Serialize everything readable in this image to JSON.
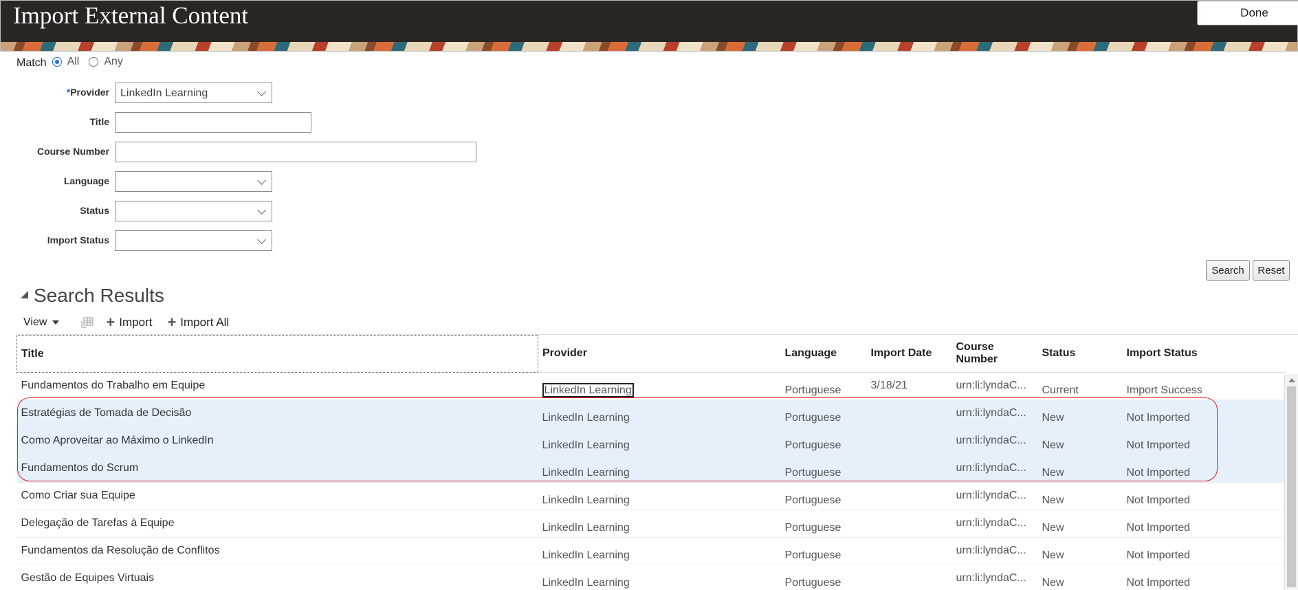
{
  "header": {
    "title": "Import External Content",
    "done_label": "Done"
  },
  "search_form": {
    "match_label": "Match",
    "match_options": [
      "All",
      "Any"
    ],
    "match_selected": "All",
    "provider": {
      "label": "Provider",
      "required_mark": "*",
      "value": "LinkedIn Learning"
    },
    "title": {
      "label": "Title",
      "value": ""
    },
    "course_number": {
      "label": "Course Number",
      "value": ""
    },
    "language": {
      "label": "Language",
      "value": ""
    },
    "status": {
      "label": "Status",
      "value": ""
    },
    "import_status": {
      "label": "Import Status",
      "value": ""
    },
    "search_label": "Search",
    "reset_label": "Reset"
  },
  "results": {
    "section_title": "Search Results",
    "toolbar": {
      "view_label": "View",
      "import_label": "Import",
      "import_all_label": "Import All"
    },
    "columns": {
      "title": "Title",
      "provider": "Provider",
      "language": "Language",
      "import_date": "Import Date",
      "course_number_1": "Course",
      "course_number_2": "Number",
      "status": "Status",
      "import_status": "Import Status"
    },
    "rows": [
      {
        "title": "Fundamentos do Trabalho em Equipe",
        "provider": "LinkedIn Learning",
        "language": "Portuguese",
        "import_date": "3/18/21",
        "course_number": "urn:li:lyndaC...",
        "status": "Current",
        "import_status": "Import Success"
      },
      {
        "title": "Estratégias de Tomada de Decisão",
        "provider": "LinkedIn Learning",
        "language": "Portuguese",
        "import_date": "",
        "course_number": "urn:li:lyndaC...",
        "status": "New",
        "import_status": "Not Imported"
      },
      {
        "title": "Como Aproveitar ao Máximo o LinkedIn",
        "provider": "LinkedIn Learning",
        "language": "Portuguese",
        "import_date": "",
        "course_number": "urn:li:lyndaC...",
        "status": "New",
        "import_status": "Not Imported"
      },
      {
        "title": "Fundamentos do Scrum",
        "provider": "LinkedIn Learning",
        "language": "Portuguese",
        "import_date": "",
        "course_number": "urn:li:lyndaC...",
        "status": "New",
        "import_status": "Not Imported"
      },
      {
        "title": "Como Criar sua Equipe",
        "provider": "LinkedIn Learning",
        "language": "Portuguese",
        "import_date": "",
        "course_number": "urn:li:lyndaC...",
        "status": "New",
        "import_status": "Not Imported"
      },
      {
        "title": "Delegação de Tarefas à Equipe",
        "provider": "LinkedIn Learning",
        "language": "Portuguese",
        "import_date": "",
        "course_number": "urn:li:lyndaC...",
        "status": "New",
        "import_status": "Not Imported"
      },
      {
        "title": "Fundamentos da Resolução de Conflitos",
        "provider": "LinkedIn Learning",
        "language": "Portuguese",
        "import_date": "",
        "course_number": "urn:li:lyndaC...",
        "status": "New",
        "import_status": "Not Imported"
      },
      {
        "title": "Gestão de Equipes Virtuais",
        "provider": "LinkedIn Learning",
        "language": "Portuguese",
        "import_date": "",
        "course_number": "urn:li:lyndaC...",
        "status": "New",
        "import_status": "Not Imported"
      }
    ]
  },
  "colors": {
    "selected_row": "#e5f0fb",
    "highlight_border": "#dd2222",
    "accent": "#1c6ed6"
  },
  "icons": {
    "freeze": "freeze-columns-icon",
    "add": "plus-icon",
    "view_menu": "caret-down-icon",
    "collapse": "collapse-triangle-icon"
  }
}
